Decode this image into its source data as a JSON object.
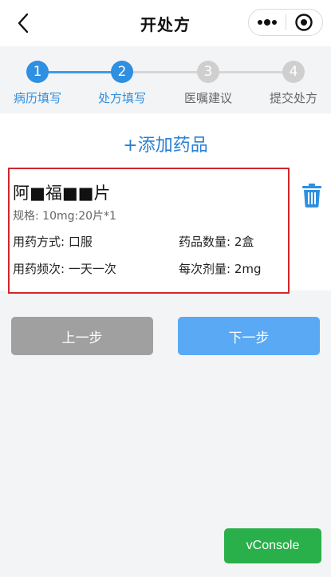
{
  "nav": {
    "title": "开处方"
  },
  "steps": [
    {
      "number": "1",
      "label": "病历填写"
    },
    {
      "number": "2",
      "label": "处方填写"
    },
    {
      "number": "3",
      "label": "医嘱建议"
    },
    {
      "number": "4",
      "label": "提交处方"
    }
  ],
  "add_drug_label": "+添加药品",
  "drug": {
    "name": "阿■福■■片",
    "spec": "规格:  10mg:20片*1",
    "usage": "用药方式:  口服",
    "quantity": "药品数量:  2盒",
    "frequency": "用药频次:  一天一次",
    "dose": "每次剂量:  2mg"
  },
  "buttons": {
    "prev": "上一步",
    "next": "下一步"
  },
  "vconsole_label": "vConsole",
  "colors": {
    "accent": "#2f8fe0",
    "highlight_border": "#d1262c",
    "vconsole": "#2ab04a"
  }
}
